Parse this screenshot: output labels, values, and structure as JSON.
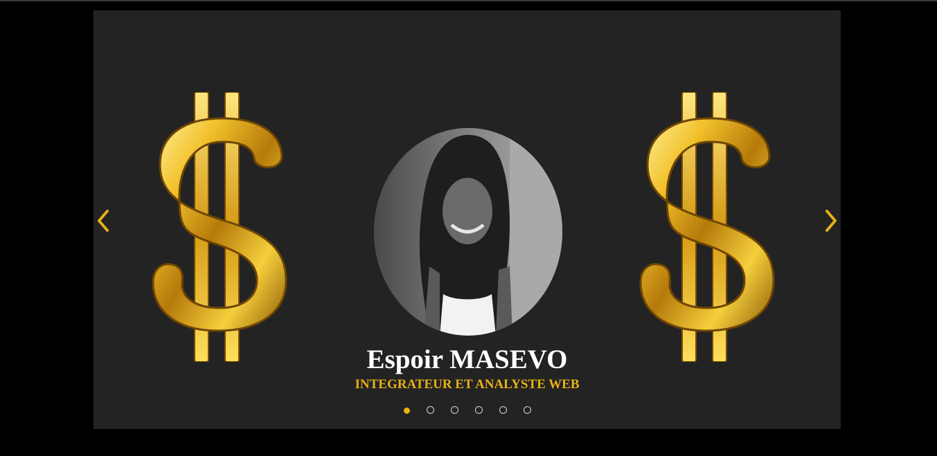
{
  "colors": {
    "background": "#000000",
    "panel": "#232323",
    "accent": "#e9b116",
    "text": "#ffffff",
    "dot_inactive": "#d8d8d8"
  },
  "slider": {
    "prev_icon": "chevron-left-icon",
    "next_icon": "chevron-right-icon",
    "decor_left_icon": "dollar-sign-icon",
    "decor_right_icon": "dollar-sign-icon",
    "profile": {
      "name": "Espoir MASEVO",
      "role": "INTEGRATEUR ET ANALYSTE WEB"
    },
    "dots": {
      "count": 6,
      "active_index": 0
    }
  }
}
